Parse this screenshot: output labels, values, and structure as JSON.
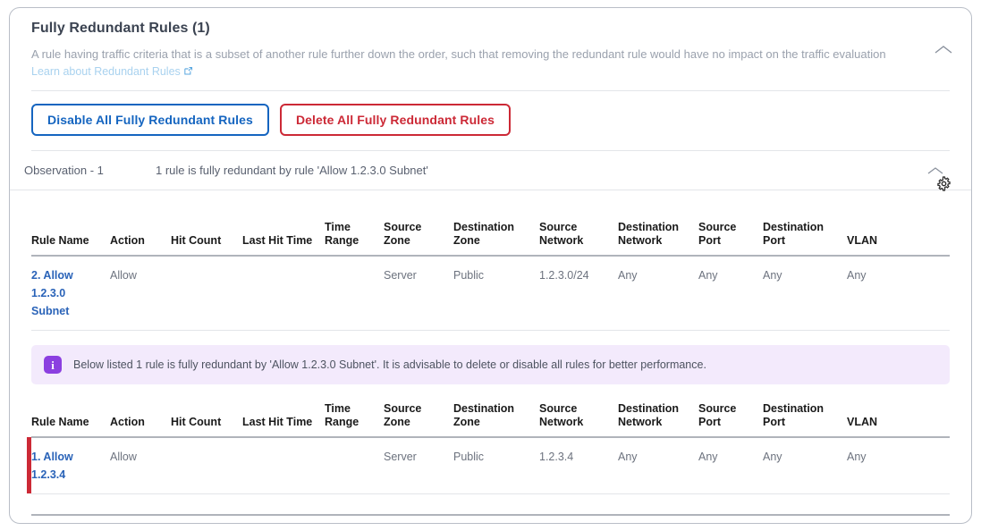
{
  "header": {
    "title": "Fully Redundant Rules (1)",
    "description": "A rule having traffic criteria that is a subset of another rule further down the order, such that removing the redundant rule would have no impact on the traffic evaluation",
    "link_text": "Learn about Redundant Rules",
    "collapse_icon": "chevron-up-icon"
  },
  "actions": {
    "disable_all_label": "Disable All Fully Redundant Rules",
    "delete_all_label": "Delete All Fully Redundant Rules",
    "disable_color": "#1565c0",
    "delete_color": "#cc2936"
  },
  "observation": {
    "label": "Observation - 1",
    "text": "1 rule is fully redundant by rule 'Allow 1.2.3.0 Subnet'",
    "collapse_icon": "chevron-up-icon"
  },
  "settings": {
    "icon": "gear-icon"
  },
  "table_columns": [
    "Rule Name",
    "Action",
    "Hit Count",
    "Last Hit Time",
    "Time Range",
    "Source Zone",
    "Destination Zone",
    "Source Network",
    "Destination Network",
    "Source Port",
    "Destination Port",
    "VLAN"
  ],
  "parent_table": {
    "rows": [
      {
        "rule_name": "2. Allow 1.2.3.0 Subnet",
        "action": "Allow",
        "hit_count": "",
        "last_hit_time": "",
        "time_range": "",
        "source_zone": "Server",
        "destination_zone": "Public",
        "source_network": "1.2.3.0/24",
        "destination_network": "Any",
        "source_port": "Any",
        "destination_port": "Any",
        "vlan": "Any"
      }
    ]
  },
  "banner": {
    "icon": "info-icon",
    "icon_glyph": "i",
    "text": "Below listed 1 rule is fully redundant by 'Allow 1.2.3.0 Subnet'. It is advisable to delete or disable all rules for better performance.",
    "background": "#f3eafc",
    "icon_color": "#8b3fe0"
  },
  "child_table": {
    "rows": [
      {
        "rule_name": "1. Allow 1.2.3.4",
        "action": "Allow",
        "hit_count": "",
        "last_hit_time": "",
        "time_range": "",
        "source_zone": "Server",
        "destination_zone": "Public",
        "source_network": "1.2.3.4",
        "destination_network": "Any",
        "source_port": "Any",
        "destination_port": "Any",
        "vlan": "Any",
        "marker_color": "#cc2936"
      }
    ]
  }
}
